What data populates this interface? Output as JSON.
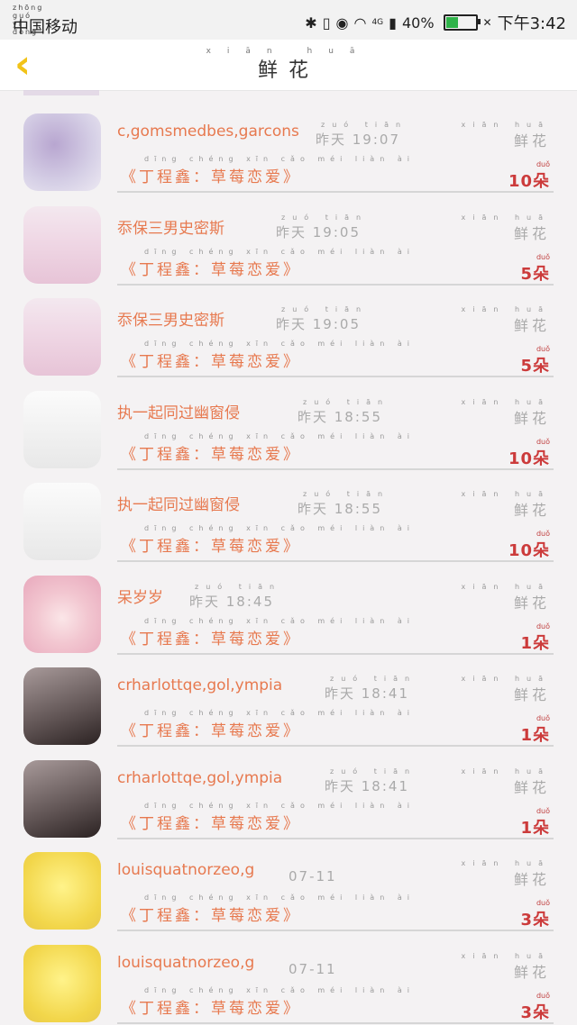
{
  "statusbar": {
    "carrier_pinyin": "zhōng guó  yí  dòng",
    "carrier": "中国移动",
    "network": "4G",
    "battery": "40%",
    "time": "下午3:42",
    "icons": [
      "bluetooth-icon",
      "vibrate-icon",
      "eye-icon",
      "wifi-icon",
      "signal-icon",
      "battery-icon",
      "alarm-icon"
    ]
  },
  "header": {
    "title_pinyin": "xiān huā",
    "title": "鲜花",
    "accent": "#f2c318"
  },
  "rows": [
    {
      "avatar": "a-blue",
      "name": "c,gomsmedbes,garcons",
      "time_pinyin": "zuó tiān",
      "time": "昨天 19:07",
      "flower_py": "xiān huā",
      "flower": "鲜花",
      "book_py": "dīng chéng xīn    cǎo méi liàn ài",
      "book": "《丁程鑫：草莓恋爱》",
      "qty_py": "duǒ",
      "qty": "10朵"
    },
    {
      "avatar": "a-pink",
      "name": "忝保三男史密斯",
      "time_pinyin": "zuó tiān",
      "time": "昨天 19:05",
      "flower_py": "xiān huā",
      "flower": "鲜花",
      "book_py": "dīng chéng xīn    cǎo méi liàn ài",
      "book": "《丁程鑫：草莓恋爱》",
      "qty_py": "duǒ",
      "qty": "5朵"
    },
    {
      "avatar": "a-pink",
      "name": "忝保三男史密斯",
      "time_pinyin": "zuó tiān",
      "time": "昨天 19:05",
      "flower_py": "xiān huā",
      "flower": "鲜花",
      "book_py": "dīng chéng xīn    cǎo méi liàn ài",
      "book": "《丁程鑫：草莓恋爱》",
      "qty_py": "duǒ",
      "qty": "5朵"
    },
    {
      "avatar": "a-sketch",
      "name": "执一起同过幽窗侵",
      "time_pinyin": "zuó tiān",
      "time": "昨天 18:55",
      "flower_py": "xiān huā",
      "flower": "鲜花",
      "book_py": "dīng chéng xīn    cǎo méi liàn ài",
      "book": "《丁程鑫：草莓恋爱》",
      "qty_py": "duǒ",
      "qty": "10朵"
    },
    {
      "avatar": "a-sketch",
      "name": "执一起同过幽窗侵",
      "time_pinyin": "zuó tiān",
      "time": "昨天 18:55",
      "flower_py": "xiān huā",
      "flower": "鲜花",
      "book_py": "dīng chéng xīn    cǎo méi liàn ài",
      "book": "《丁程鑫：草莓恋爱》",
      "qty_py": "duǒ",
      "qty": "10朵"
    },
    {
      "avatar": "a-anime",
      "name": "呆岁岁",
      "time_pinyin": "zuó tiān",
      "time": "昨天 18:45",
      "flower_py": "xiān huā",
      "flower": "鲜花",
      "book_py": "dīng chéng xīn    cǎo méi liàn ài",
      "book": "《丁程鑫：草莓恋爱》",
      "qty_py": "duǒ",
      "qty": "1朵"
    },
    {
      "avatar": "a-cup",
      "name": "crharlottqe,gol,ympia",
      "time_pinyin": "zuó tiān",
      "time": "昨天 18:41",
      "flower_py": "xiān huā",
      "flower": "鲜花",
      "book_py": "dīng chéng xīn    cǎo méi liàn ài",
      "book": "《丁程鑫：草莓恋爱》",
      "qty_py": "duǒ",
      "qty": "1朵"
    },
    {
      "avatar": "a-cup",
      "name": "crharlottqe,gol,ympia",
      "time_pinyin": "zuó tiān",
      "time": "昨天 18:41",
      "flower_py": "xiān huā",
      "flower": "鲜花",
      "book_py": "dīng chéng xīn    cǎo méi liàn ài",
      "book": "《丁程鑫：草莓恋爱》",
      "qty_py": "duǒ",
      "qty": "1朵"
    },
    {
      "avatar": "a-yellow",
      "name": "louisquatnorzeo,g",
      "time_pinyin": "",
      "time": "07-11",
      "flower_py": "xiān huā",
      "flower": "鲜花",
      "book_py": "dīng chéng xīn    cǎo méi liàn ài",
      "book": "《丁程鑫：草莓恋爱》",
      "qty_py": "duǒ",
      "qty": "3朵"
    },
    {
      "avatar": "a-yellow",
      "name": "louisquatnorzeo,g",
      "time_pinyin": "",
      "time": "07-11",
      "flower_py": "xiān huā",
      "flower": "鲜花",
      "book_py": "dīng chéng xīn    cǎo méi liàn ài",
      "book": "《丁程鑫：草莓恋爱》",
      "qty_py": "duǒ",
      "qty": "3朵"
    }
  ]
}
